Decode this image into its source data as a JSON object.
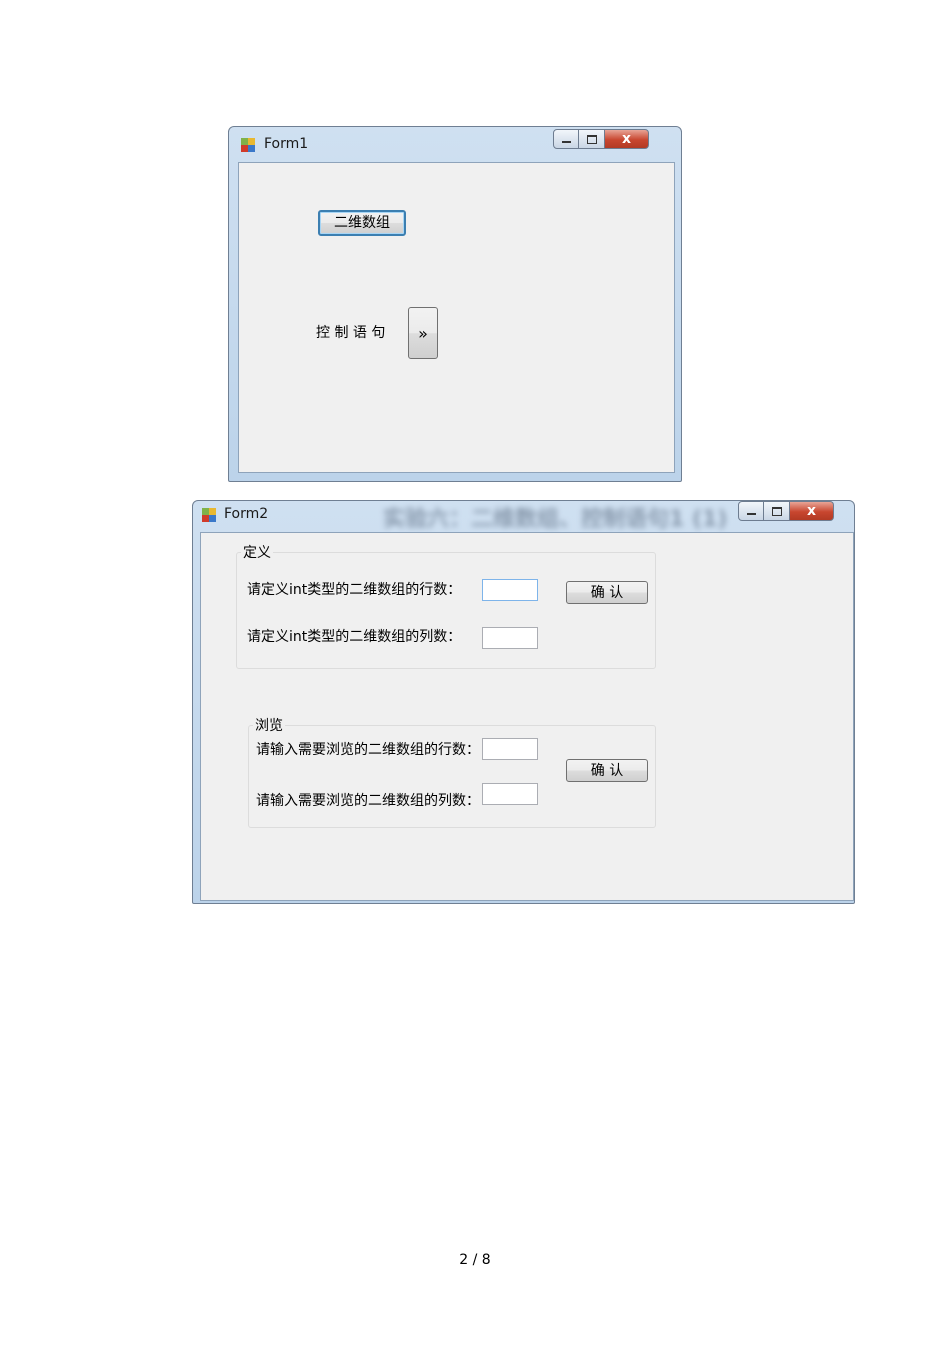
{
  "form1": {
    "title": "Form1",
    "button_2d_array": "二维数组",
    "control_label": "控 制 语 句",
    "expand_button": "»",
    "close_glyph": "x"
  },
  "form2": {
    "title": "Form2",
    "blurred_title_text": "实验六：二维数组、控制语句1 (1)",
    "close_glyph": "x",
    "define_group": {
      "title": "定义",
      "rows_label": "请定义int类型的二维数组的行数：",
      "cols_label": "请定义int类型的二维数组的列数：",
      "rows_value": "",
      "cols_value": "",
      "confirm": "确 认"
    },
    "browse_group": {
      "title": "浏览",
      "rows_label": "请输入需要浏览的二维数组的行数：",
      "cols_label": "请输入需要浏览的二维数组的列数：",
      "rows_value": "",
      "cols_value": "",
      "confirm": "确 认"
    }
  },
  "page_number": "2 / 8",
  "colors": {
    "frame": "#bcd3ea",
    "client": "#f0f0f0",
    "close_button": "#c8462f"
  },
  "icons": [
    "app-icon",
    "minimize-icon",
    "maximize-icon",
    "close-icon"
  ]
}
